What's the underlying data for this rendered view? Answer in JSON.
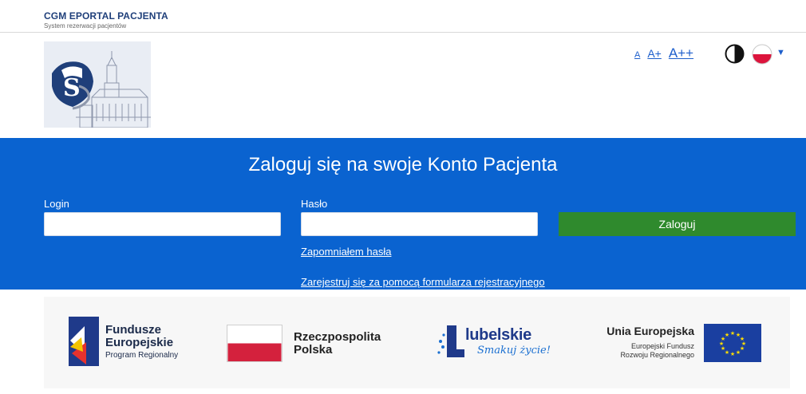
{
  "header": {
    "brand_title": "CGM EPORTAL PACJENTA",
    "brand_subtitle": "System rezerwacji pacjentów"
  },
  "accessibility": {
    "font_small": "A",
    "font_medium": "A+",
    "font_large": "A++",
    "contrast_icon": "contrast-toggle-icon",
    "language_icon": "poland-flag-icon",
    "language_caret": "▼"
  },
  "login": {
    "title": "Zaloguj się na swoje Konto Pacjenta",
    "login_label": "Login",
    "login_value": "",
    "password_label": "Hasło",
    "password_value": "",
    "submit_label": "Zaloguj",
    "forgot_password": "Zapomniałem hasła",
    "register": "Zarejestruj się za pomocą formularza rejestracyjnego"
  },
  "footer_logos": {
    "fe_line1": "Fundusze",
    "fe_line2": "Europejskie",
    "fe_line3": "Program Regionalny",
    "rp_line1": "Rzeczpospolita",
    "rp_line2": "Polska",
    "lubelskie": "lubelskie",
    "lubelskie_tag": "Smakuj życie!",
    "ue_title": "Unia Europejska",
    "ue_line1": "Europejski Fundusz",
    "ue_line2": "Rozwoju Regionalnego"
  },
  "colors": {
    "band": "#0a63d0",
    "button": "#2f8a2d",
    "brand": "#1f3f7a",
    "link": "#1e5fcc"
  }
}
